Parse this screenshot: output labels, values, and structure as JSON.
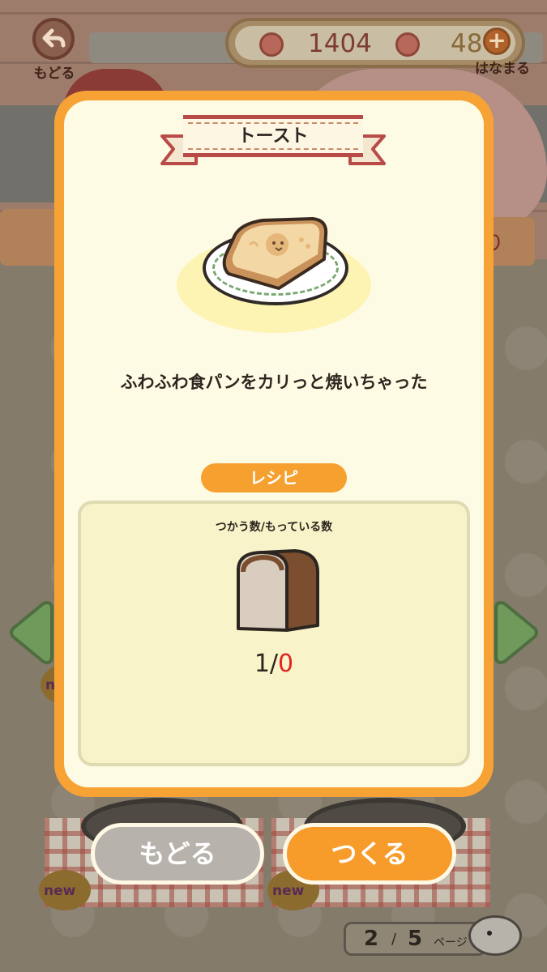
{
  "header": {
    "back_label": "もどる",
    "flowers_count": "1404",
    "hanamaru_count": "48",
    "hanamaru_label": "はなまる"
  },
  "background": {
    "sign_text": "り",
    "new_badge": "new"
  },
  "recipe_card": {
    "title": "トースト",
    "description": "ふわふわ食パンをカリっと焼いちゃった",
    "recipe_label": "レシピ",
    "usage_header": "つかう数/もっている数",
    "ingredient": {
      "icon": "bread-loaf-icon",
      "need": "1",
      "separator": "/",
      "have": "0"
    }
  },
  "buttons": {
    "back": "もどる",
    "make": "つくる"
  },
  "pager": {
    "current": "2",
    "slash": "/",
    "total": "5",
    "unit": "ページ"
  },
  "colors": {
    "modal_border": "#f7a234",
    "modal_body": "#fefbe4",
    "ribbon_red": "#b84a47",
    "make_button": "#f79b2a",
    "back_button": "#b7b2ab",
    "have_zero": "#e2241f"
  }
}
